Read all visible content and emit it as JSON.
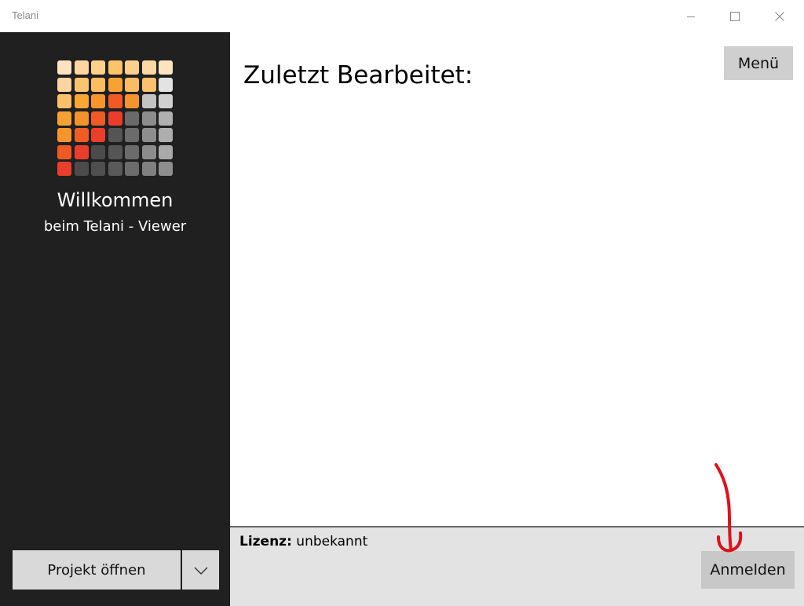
{
  "window": {
    "title": "Telani",
    "minimize_icon": "minimize-icon",
    "maximize_icon": "maximize-icon",
    "close_icon": "close-icon"
  },
  "sidebar": {
    "background": "#202020",
    "logo": {
      "icon": "telani-logo",
      "colors": [
        [
          "#fde3c0",
          "#fdd5a0",
          "#fcd08d",
          "#fbc36a",
          "#fbd08c",
          "#fcd9a3",
          "#fde4c1"
        ],
        [
          "#fdd4a0",
          "#fbc56f",
          "#fbbd5e",
          "#f8a232",
          "#fbbd63",
          "#fbc16c",
          "#e3e3e3"
        ],
        [
          "#fbc16a",
          "#f8a634",
          "#f6962a",
          "#f15a24",
          "#f5942c",
          "#c3c3c3",
          "#d0d0d0"
        ],
        [
          "#f7a134",
          "#f4922b",
          "#ef5b25",
          "#ea3d2b",
          "#6a6a6a",
          "#8c8c8c",
          "#b0b0b0"
        ],
        [
          "#f6952b",
          "#f05c25",
          "#eb3e2c",
          "#555555",
          "#6b6b6b",
          "#8d8d8d",
          "#aeaeae"
        ],
        [
          "#ef5a24",
          "#eb3d2c",
          "#4b4b4b",
          "#555555",
          "#6b6b6b",
          "#8c8c8c",
          "#a9a9a9"
        ],
        [
          "#ea3d2b",
          "#4b4b4b",
          "#4f4f4f",
          "#5a5a5a",
          "#6c6c6c",
          "#808080",
          "#8e8e8e"
        ]
      ]
    },
    "welcome_title": "Willkommen",
    "welcome_subtitle": "beim Telani - Viewer",
    "open_project_label": "Projekt öffnen",
    "dropdown_icon": "chevron-down-icon"
  },
  "main": {
    "recent_title": "Zuletzt Bearbeitet:",
    "menu_label": "Menü"
  },
  "footer": {
    "license_label": "Lizenz:",
    "license_value": "unbekannt",
    "login_label": "Anmelden"
  },
  "annotation": {
    "color": "#e0101a",
    "icon": "hand-drawn-arrow"
  }
}
